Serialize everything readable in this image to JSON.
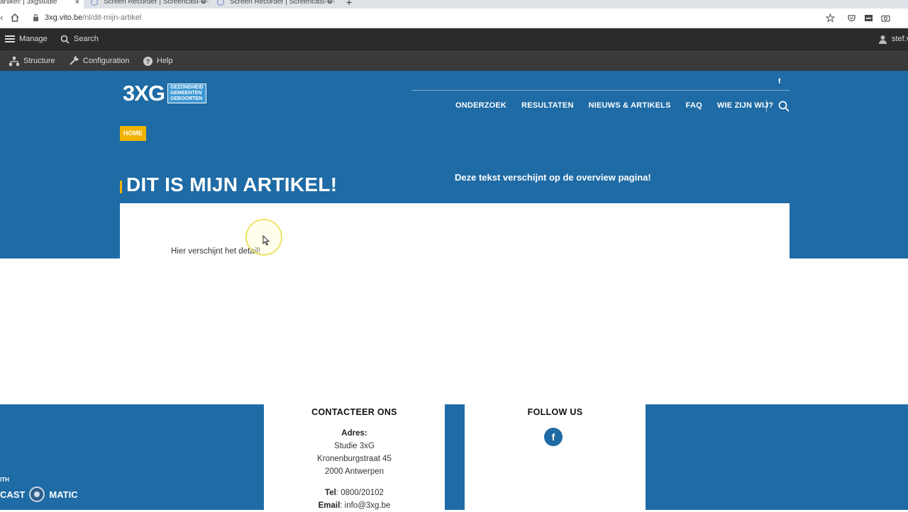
{
  "browser": {
    "tabs": [
      {
        "title": "artikel! | 3xgstudie",
        "close": "×"
      },
      {
        "title": "Screen Recorder | Screencast-O-",
        "close": "×"
      },
      {
        "title": "Screen Recorder | Screencast-O-",
        "close": "×"
      }
    ],
    "new_tab": "+",
    "url_host": "3xg.vito.be",
    "url_path": "/nl/dit-mijn-artikel"
  },
  "admin_toolbar": {
    "manage": "Manage",
    "search": "Search",
    "user": "stef.v",
    "structure": "Structure",
    "configuration": "Configuration",
    "help": "Help"
  },
  "site": {
    "logo_text": "3XG",
    "logo_lines": [
      "GEZONDHEID",
      "GEMEENTEN",
      "GEBOORTEN"
    ],
    "top_social": "f",
    "nav": [
      "ONDERZOEK",
      "RESULTATEN",
      "NIEUWS & ARTIKELS",
      "FAQ",
      "WIE ZIJN WIJ?"
    ],
    "breadcrumb": "HOME",
    "title": "DIT IS MIJN ARTIKEL!",
    "intro": "Deze tekst verschijnt op de overview pagina!",
    "detail": "Hier verschijnt het detail!"
  },
  "footer": {
    "contact_title": "CONTACTEER ONS",
    "address_label": "Adres",
    "address_lines": [
      "Studie 3xG",
      "Kronenburgstraat 45",
      "2000 Antwerpen"
    ],
    "tel_label": "Tel",
    "tel": "0800/20102",
    "email_label": "Email",
    "email": "info@3xg.be",
    "follow_title": "FOLLOW US",
    "follow_icon": "f"
  },
  "watermark": {
    "small": "ITH",
    "left": "CAST",
    "right": "MATIC"
  },
  "colors": {
    "brand_blue": "#1e6ba5",
    "accent_yellow": "#f0b400",
    "toolbar_dark": "#2b2b2b"
  }
}
